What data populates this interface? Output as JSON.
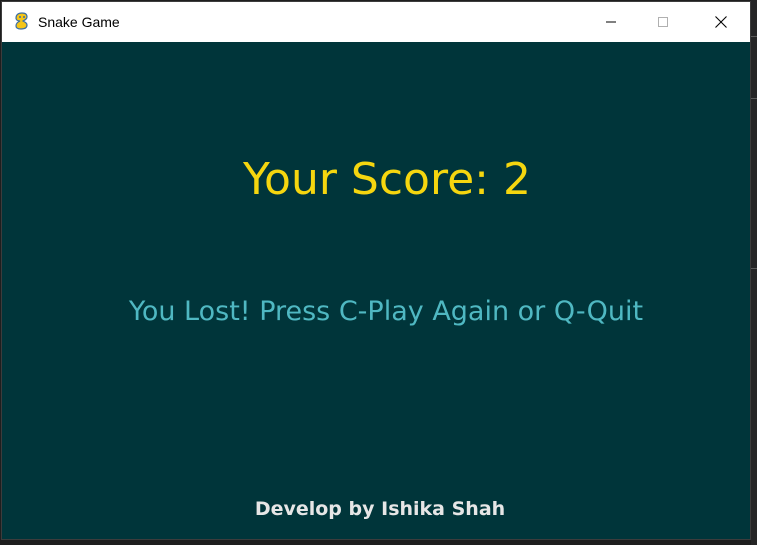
{
  "window": {
    "title": "Snake Game",
    "icon": "pygame-snake-icon"
  },
  "controls": {
    "minimize_icon": "minimize-icon",
    "maximize_icon": "maximize-icon",
    "close_icon": "close-icon"
  },
  "game": {
    "score_text": "Your Score: 2",
    "lost_message": "You Lost! Press C-Play Again or Q-Quit",
    "credit": "Develop by Ishika Shah"
  },
  "colors": {
    "background": "#00353a",
    "score": "#f5d60f",
    "message": "#4fb8c2",
    "credit": "#e6e6e6"
  }
}
